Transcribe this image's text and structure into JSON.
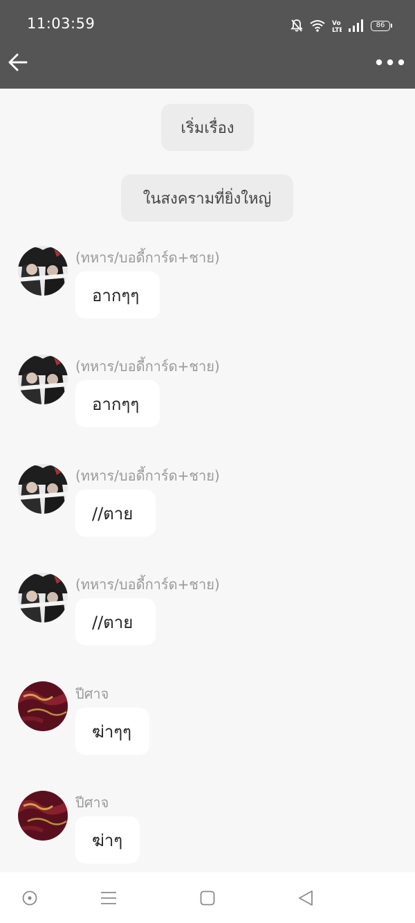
{
  "status_bar": {
    "time": "11:03:59",
    "battery": "86",
    "icons": [
      "mute-bell-icon",
      "wifi-icon",
      "volte-icon",
      "signal-icon",
      "battery-icon"
    ]
  },
  "header": {
    "back_icon": "arrow-left-icon",
    "more_icon": "ellipsis-icon",
    "bar_color": "#555555"
  },
  "system_messages": [
    {
      "text": "เริ่มเรื่อง"
    },
    {
      "text": "ในสงครามที่ยิ่งใหญ่"
    }
  ],
  "messages": [
    {
      "sender": "(ทหาร/บอดี้การ์ด+ชาย)",
      "text": "อากๆๆ",
      "avatar": "anime-character-avatar"
    },
    {
      "sender": "(ทหาร/บอดี้การ์ด+ชาย)",
      "text": "อากๆๆ",
      "avatar": "anime-character-avatar"
    },
    {
      "sender": "(ทหาร/บอดี้การ์ด+ชาย)",
      "text": "//ตาย",
      "avatar": "anime-character-avatar"
    },
    {
      "sender": "(ทหาร/บอดี้การ์ด+ชาย)",
      "text": "//ตาย",
      "avatar": "anime-character-avatar"
    },
    {
      "sender": "ปีศาจ",
      "text": "ฆ่าๆๆ",
      "avatar": "crimson-gold-avatar"
    },
    {
      "sender": "ปีศาจ",
      "text": "ฆ่าๆ",
      "avatar": "crimson-gold-avatar"
    }
  ],
  "nav_bar": {
    "icons": [
      "circle-dot-icon",
      "menu-lines-icon",
      "square-icon",
      "triangle-back-icon"
    ]
  }
}
